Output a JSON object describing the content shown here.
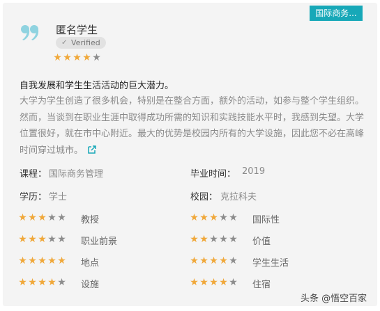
{
  "badge": "国际商务...",
  "reviewer": {
    "name": "匿名学生",
    "verified": "Verified",
    "overall_rating": 4,
    "max_rating": 5
  },
  "review": {
    "title": "自我发展和学生生活活动的巨大潜力。",
    "body": "大学为学生创造了很多机会，特别是在整合方面，额外的活动，如参与整个学生组织。然而，当谈到在职业生涯中取得成功所需的知识和实践技能水平时，我感到失望。大学位置很好，就在市中心附近。最大的优势是校园内所有的大学设施，因此您不必在高峰时间穿过城市。"
  },
  "details": {
    "course_label": "课程：",
    "course_value": "国际商务管理",
    "grad_label": "毕业时间：",
    "grad_value": "2019",
    "degree_label": "学历：",
    "degree_value": "学士",
    "campus_label": "校园：",
    "campus_value": "克拉科夫"
  },
  "ratings": [
    {
      "label": "教授",
      "value": 3
    },
    {
      "label": "国际性",
      "value": 3
    },
    {
      "label": "职业前景",
      "value": 3
    },
    {
      "label": "价值",
      "value": 2
    },
    {
      "label": "地点",
      "value": 5
    },
    {
      "label": "学生生活",
      "value": 4
    },
    {
      "label": "设施",
      "value": 4
    },
    {
      "label": "住宿",
      "value": 4
    }
  ],
  "watermark": "头条 @悟空百家",
  "colors": {
    "star_on": "#f0a83a",
    "star_off": "#8c8c8c",
    "badge_bg": "#17a8b8",
    "card_bg": "#f4f4f4"
  },
  "icons": {
    "quote": "quote-icon",
    "verified": "check-icon",
    "external_link": "external-link-icon",
    "star": "star-icon"
  }
}
